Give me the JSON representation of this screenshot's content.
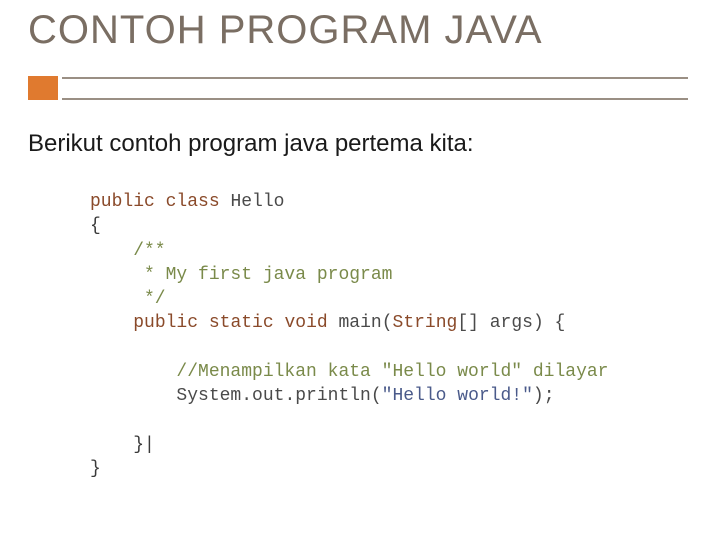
{
  "title": "CONTOH PROGRAM JAVA",
  "subtitle": "Berikut contoh program java pertema kita:",
  "code": {
    "l1_kw1": "public",
    "l1_kw2": "class",
    "l1_cls": "Hello",
    "l2": "{",
    "l3": "    /**",
    "l4": "     * My first java program",
    "l5": "     */",
    "l6_kw1": "public",
    "l6_kw2": "static",
    "l6_kw3": "void",
    "l6_main": "main",
    "l6_sig1": "(",
    "l6_ty": "String",
    "l6_sig2": "[] args) {",
    "l7": "",
    "l8": "        //Menampilkan kata \"Hello world\" dilayar",
    "l9a": "        System.",
    "l9b": "out",
    "l9c": ".println(",
    "l9d": "\"Hello world!\"",
    "l9e": ");",
    "l10": "",
    "l11": "    }|",
    "l12": "}"
  }
}
